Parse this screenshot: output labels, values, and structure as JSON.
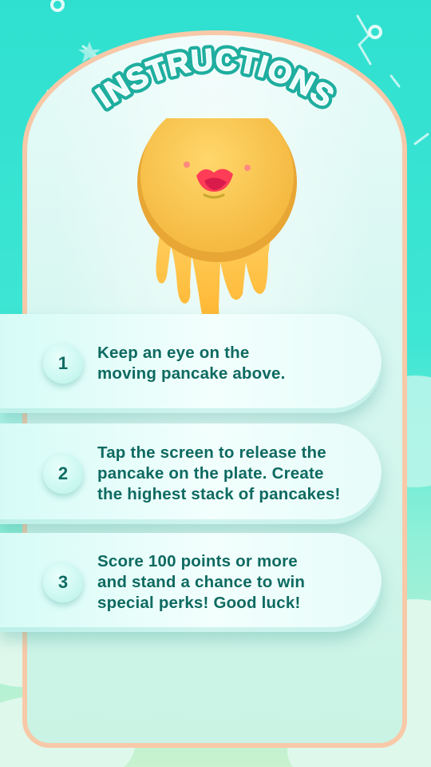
{
  "screen": {
    "title": "INSTRUCTIONS",
    "steps": [
      {
        "number": "1",
        "lines": [
          "Keep an eye on the",
          "moving pancake above."
        ]
      },
      {
        "number": "2",
        "lines": [
          "Tap the screen to release the",
          "pancake on the plate. Create",
          "the highest stack of pancakes!"
        ]
      },
      {
        "number": "3",
        "lines": [
          "Score 100 points or more",
          "and stand a chance to win",
          "special perks! Good luck!"
        ]
      }
    ]
  },
  "colors": {
    "background": "#2fe0d0",
    "card_border": "#f7c9a8",
    "title_fill": "#e8fffb",
    "title_stroke": "#1fae9f",
    "text": "#0e6a61",
    "pancake": "#f8c24e",
    "syrup": "#ffbf3f"
  },
  "icons": {
    "mascot": "pancake-face-icon",
    "decor": [
      "sparkle-icon",
      "ring-icon",
      "confetti-icon"
    ]
  }
}
